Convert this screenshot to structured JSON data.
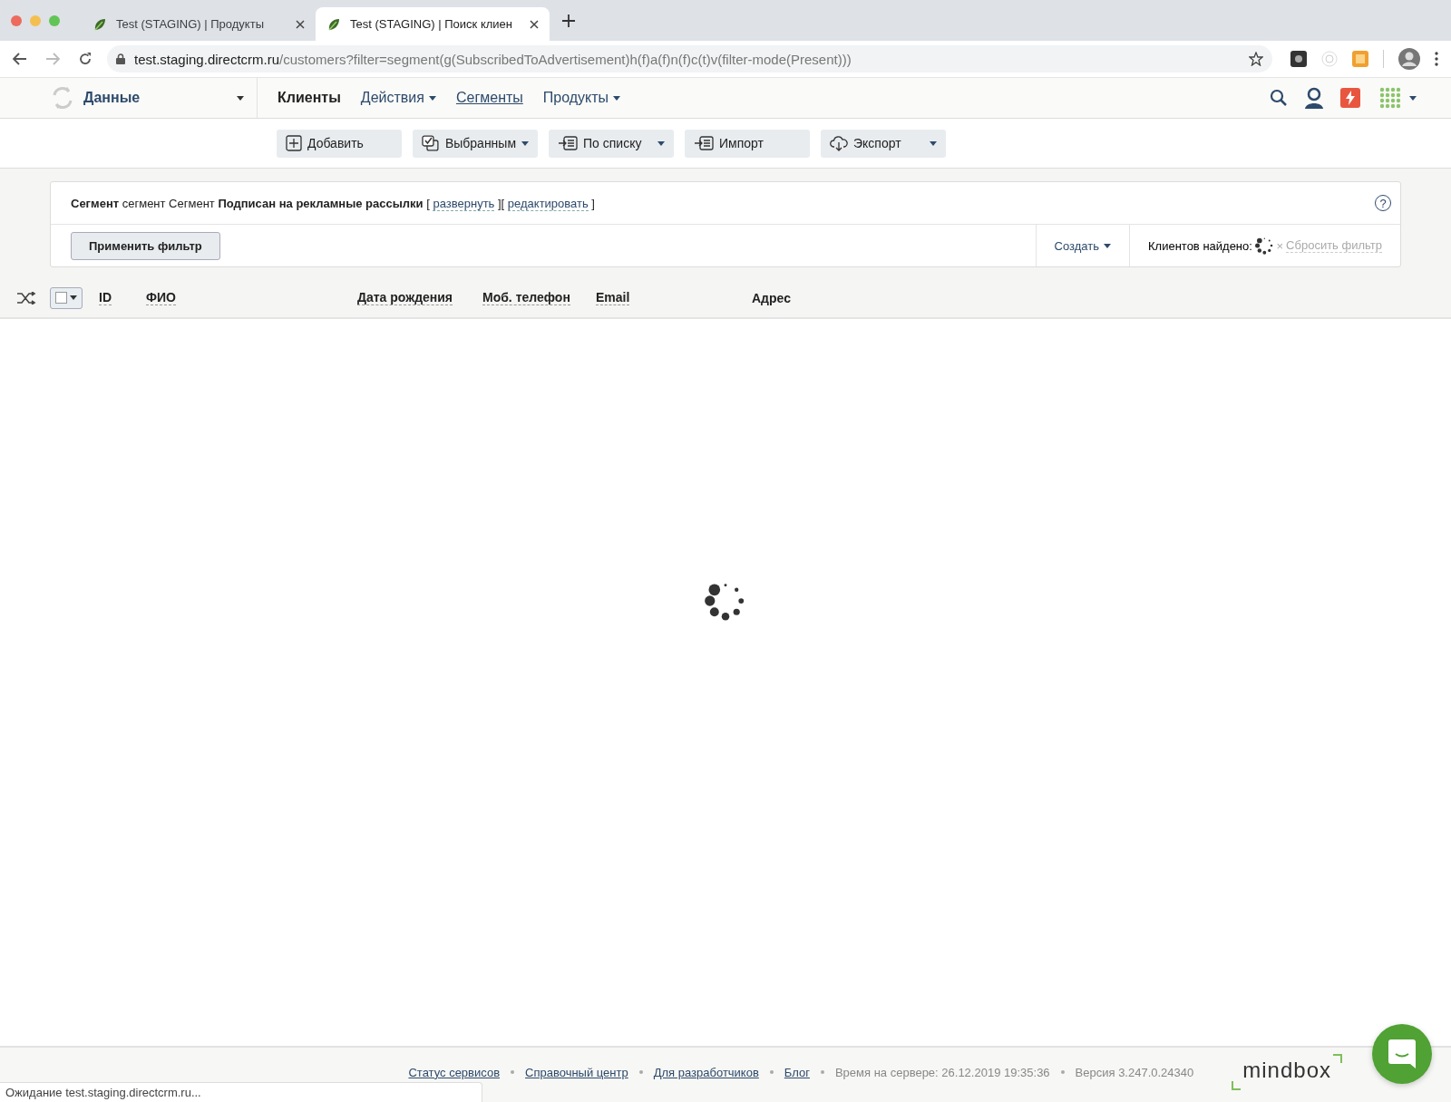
{
  "browser": {
    "tabs": [
      {
        "title": "Test (STAGING) | Продукты",
        "selected": false
      },
      {
        "title": "Test (STAGING) | Поиск клиен",
        "selected": true
      }
    ],
    "url_host": "test.staging.directcrm.ru",
    "url_path": "/customers?filter=segment(g(SubscribedToAdvertisement)h(f)a(f)n(f)c(t)v(filter-mode(Present)))"
  },
  "app": {
    "section": "Данные",
    "nav": [
      {
        "label": "Клиенты",
        "selected": true,
        "has_menu": false,
        "underlined": false
      },
      {
        "label": "Действия",
        "selected": false,
        "has_menu": true,
        "underlined": false
      },
      {
        "label": "Сегменты",
        "selected": false,
        "has_menu": false,
        "underlined": true
      },
      {
        "label": "Продукты",
        "selected": false,
        "has_menu": true,
        "underlined": false
      }
    ]
  },
  "toolbar": [
    {
      "label": "Добавить",
      "has_menu": false
    },
    {
      "label": "Выбранным",
      "has_menu": true
    },
    {
      "label": "По списку",
      "has_menu": true
    },
    {
      "label": "Импорт",
      "has_menu": false
    },
    {
      "label": "Экспорт",
      "has_menu": true
    }
  ],
  "filter": {
    "description": [
      {
        "kind": "text",
        "text": "**Сегмент** сегмент Сегмент **Подписан на рекламные рассылки** ["
      },
      {
        "kind": "link",
        "text": "развернуть"
      },
      {
        "kind": "text",
        "text": "]["
      },
      {
        "kind": "link",
        "text": "редактировать"
      },
      {
        "kind": "text",
        "text": "]"
      }
    ],
    "help_mark": "?",
    "apply_button": "Применить фильтр",
    "create_menu": "Создать",
    "found_label": "Клиентов найдено:",
    "reset_mark": "×",
    "reset_link": "Сбросить фильтр"
  },
  "table": {
    "select_all": {
      "checked": false
    },
    "columns": [
      {
        "label": "ID",
        "sortable": true
      },
      {
        "label": "ФИО",
        "sortable": true
      },
      {
        "label": "Дата рождения",
        "sortable": true
      },
      {
        "label": "Моб. телефон",
        "sortable": true
      },
      {
        "label": "Email",
        "sortable": true
      },
      {
        "label": "Адрес",
        "sortable": false
      }
    ]
  },
  "footer": {
    "links": [
      "Статус сервисов",
      "Справочный центр",
      "Для разработчиков",
      "Блог"
    ],
    "server_time": "Время на сервере: 26.12.2019 19:35:36",
    "version": "Версия 3.247.0.24340",
    "logo": "mindbox"
  },
  "status_bar": "Ожидание test.staging.directcrm.ru..."
}
